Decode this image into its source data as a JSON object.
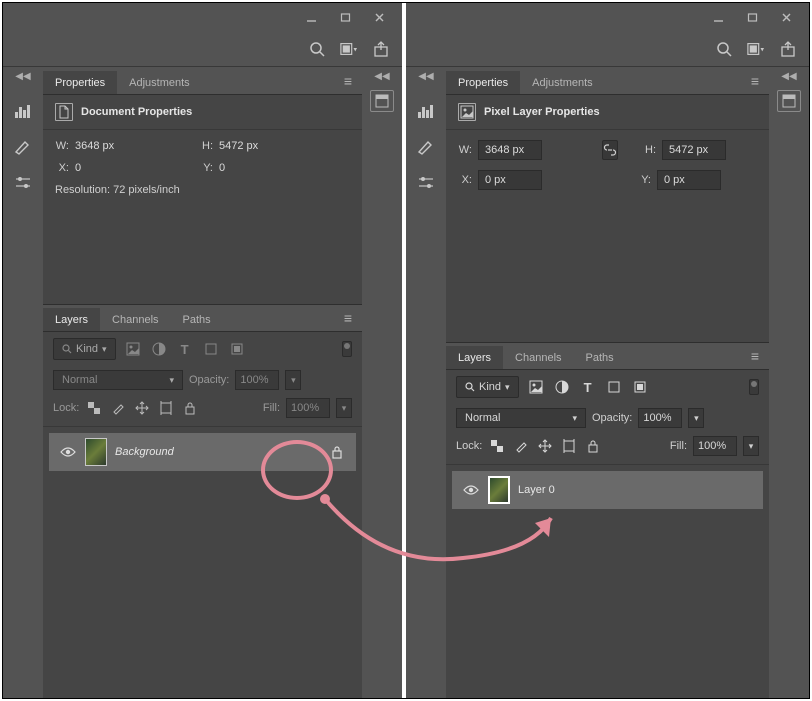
{
  "left": {
    "tabs": {
      "properties": "Properties",
      "adjustments": "Adjustments"
    },
    "section_title": "Document Properties",
    "props": {
      "w_label": "W:",
      "w_value": "3648 px",
      "h_label": "H:",
      "h_value": "5472 px",
      "x_label": "X:",
      "x_value": "0",
      "y_label": "Y:",
      "y_value": "0",
      "resolution": "Resolution: 72 pixels/inch"
    },
    "layers_tabs": {
      "layers": "Layers",
      "channels": "Channels",
      "paths": "Paths"
    },
    "filter": {
      "kind_label": "Kind"
    },
    "blend": {
      "mode": "Normal",
      "opacity_label": "Opacity:",
      "opacity_value": "100%",
      "fill_label": "Fill:",
      "fill_value": "100%",
      "lock_label": "Lock:"
    },
    "layer": {
      "name": "Background"
    }
  },
  "right": {
    "tabs": {
      "properties": "Properties",
      "adjustments": "Adjustments"
    },
    "section_title": "Pixel Layer Properties",
    "props": {
      "w_label": "W:",
      "w_value": "3648 px",
      "h_label": "H:",
      "h_value": "5472 px",
      "x_label": "X:",
      "x_value": "0 px",
      "y_label": "Y:",
      "y_value": "0 px"
    },
    "layers_tabs": {
      "layers": "Layers",
      "channels": "Channels",
      "paths": "Paths"
    },
    "filter": {
      "kind_label": "Kind"
    },
    "blend": {
      "mode": "Normal",
      "opacity_label": "Opacity:",
      "opacity_value": "100%",
      "fill_label": "Fill:",
      "fill_value": "100%",
      "lock_label": "Lock:"
    },
    "layer": {
      "name": "Layer 0"
    }
  }
}
